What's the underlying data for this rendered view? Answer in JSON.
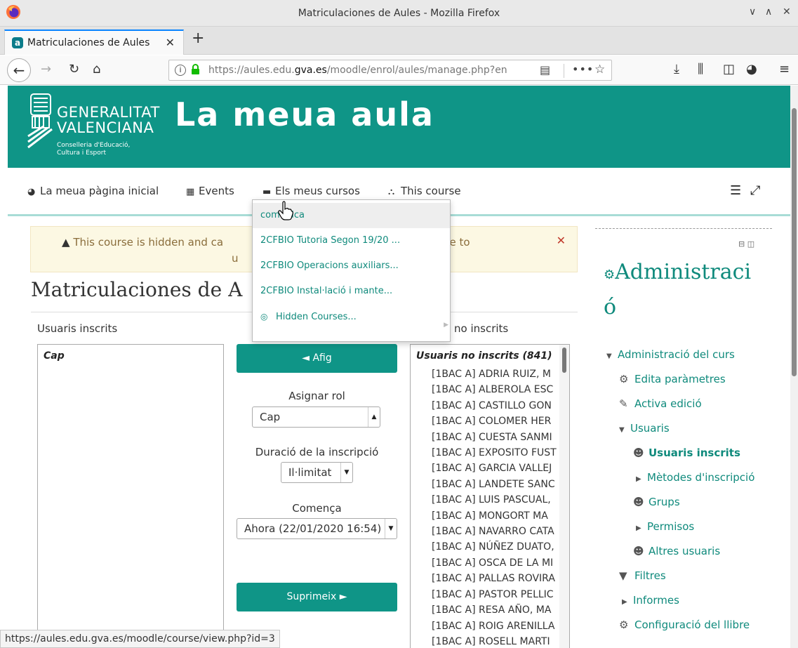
{
  "window": {
    "title": "Matriculaciones de Aules - Mozilla Firefox",
    "controls": [
      "∨",
      "∧",
      "✕"
    ]
  },
  "tab": {
    "label": "Matriculaciones de Aules",
    "close": "✕",
    "new": "+"
  },
  "navbar": {
    "url_prefix": "https://aules.edu.",
    "url_domain": "gva.es",
    "url_suffix": "/moodle/enrol/aules/manage.php?en"
  },
  "header": {
    "org_line1": "GENERALITAT",
    "org_line2": "VALENCIANA",
    "org_sub1": "Conselleria d'Educació,",
    "org_sub2": "Cultura i Esport",
    "site_name": "La meua aula"
  },
  "menu": {
    "home": "La meua pàgina inicial",
    "events": "Events",
    "my_courses": "Els meus cursos",
    "this_course": "This course"
  },
  "dropdown": {
    "items": [
      "comunica",
      "2CFBIO Tutoria Segon 19/20 ...",
      "2CFBIO Operacions auxiliars...",
      "2CFBIO Instal·lació i mante...",
      "Hidden Courses..."
    ]
  },
  "alert": {
    "line1": "This course is hidden and ca",
    "line1_end": "ick here to",
    "line2": "u",
    "close": "✕"
  },
  "page_heading": "Matriculaciones de A",
  "enrol": {
    "left_label": "Usuaris inscrits",
    "right_label": "no inscrits",
    "left_option": "Cap",
    "add_button": "◄ Afig",
    "role_label": "Asignar rol",
    "role_value": "Cap",
    "duration_label": "Duració de la inscripció",
    "duration_value": "Il·limitat",
    "start_label": "Comença",
    "start_value": "Ahora (22/01/2020 16:54)",
    "remove_button": "Suprimeix ►",
    "right_group": "Usuaris no inscrits (841)",
    "users": [
      "[1BAC A] ADRIA RUIZ, M",
      "[1BAC A] ALBEROLA ESC",
      "[1BAC A] CASTILLO GON",
      "[1BAC A] COLOMER HER",
      "[1BAC A] CUESTA SANMI",
      "[1BAC A] EXPOSITO FUST",
      "[1BAC A] GARCIA VALLEJ",
      "[1BAC A] LANDETE SANC",
      "[1BAC A] LUIS PASCUAL,",
      "[1BAC A] MONGORT MA",
      "[1BAC A] NAVARRO CATA",
      "[1BAC A] NÚÑEZ DUATO,",
      "[1BAC A] OSCA DE LA MI",
      "[1BAC A] PALLAS ROVIRA",
      "[1BAC A] PASTOR PELLIC",
      "[1BAC A] RESA AÑO, MA",
      "[1BAC A] ROIG ARENILLA",
      "[1BAC A] ROSELL MARTI"
    ]
  },
  "admin": {
    "title_line1": "Administraci",
    "title_line2": "ó",
    "tree": {
      "course_admin": "Administració del curs",
      "edit_params": "Edita paràmetres",
      "activate_edit": "Activa edició",
      "users": "Usuaris",
      "enrolled_users": "Usuaris inscrits",
      "enrol_methods": "Mètodes d'inscripció",
      "groups": "Grups",
      "permissions": "Permisos",
      "other_users": "Altres usuaris",
      "filters": "Filtres",
      "reports": "Informes",
      "gradebook_setup": "Configuració del llibre"
    }
  },
  "status_url": "https://aules.edu.gva.es/moodle/course/view.php?id=3",
  "colors": {
    "brand": "#0f9587",
    "link": "#0f8a7c",
    "alert_bg": "#fcf8e3"
  }
}
